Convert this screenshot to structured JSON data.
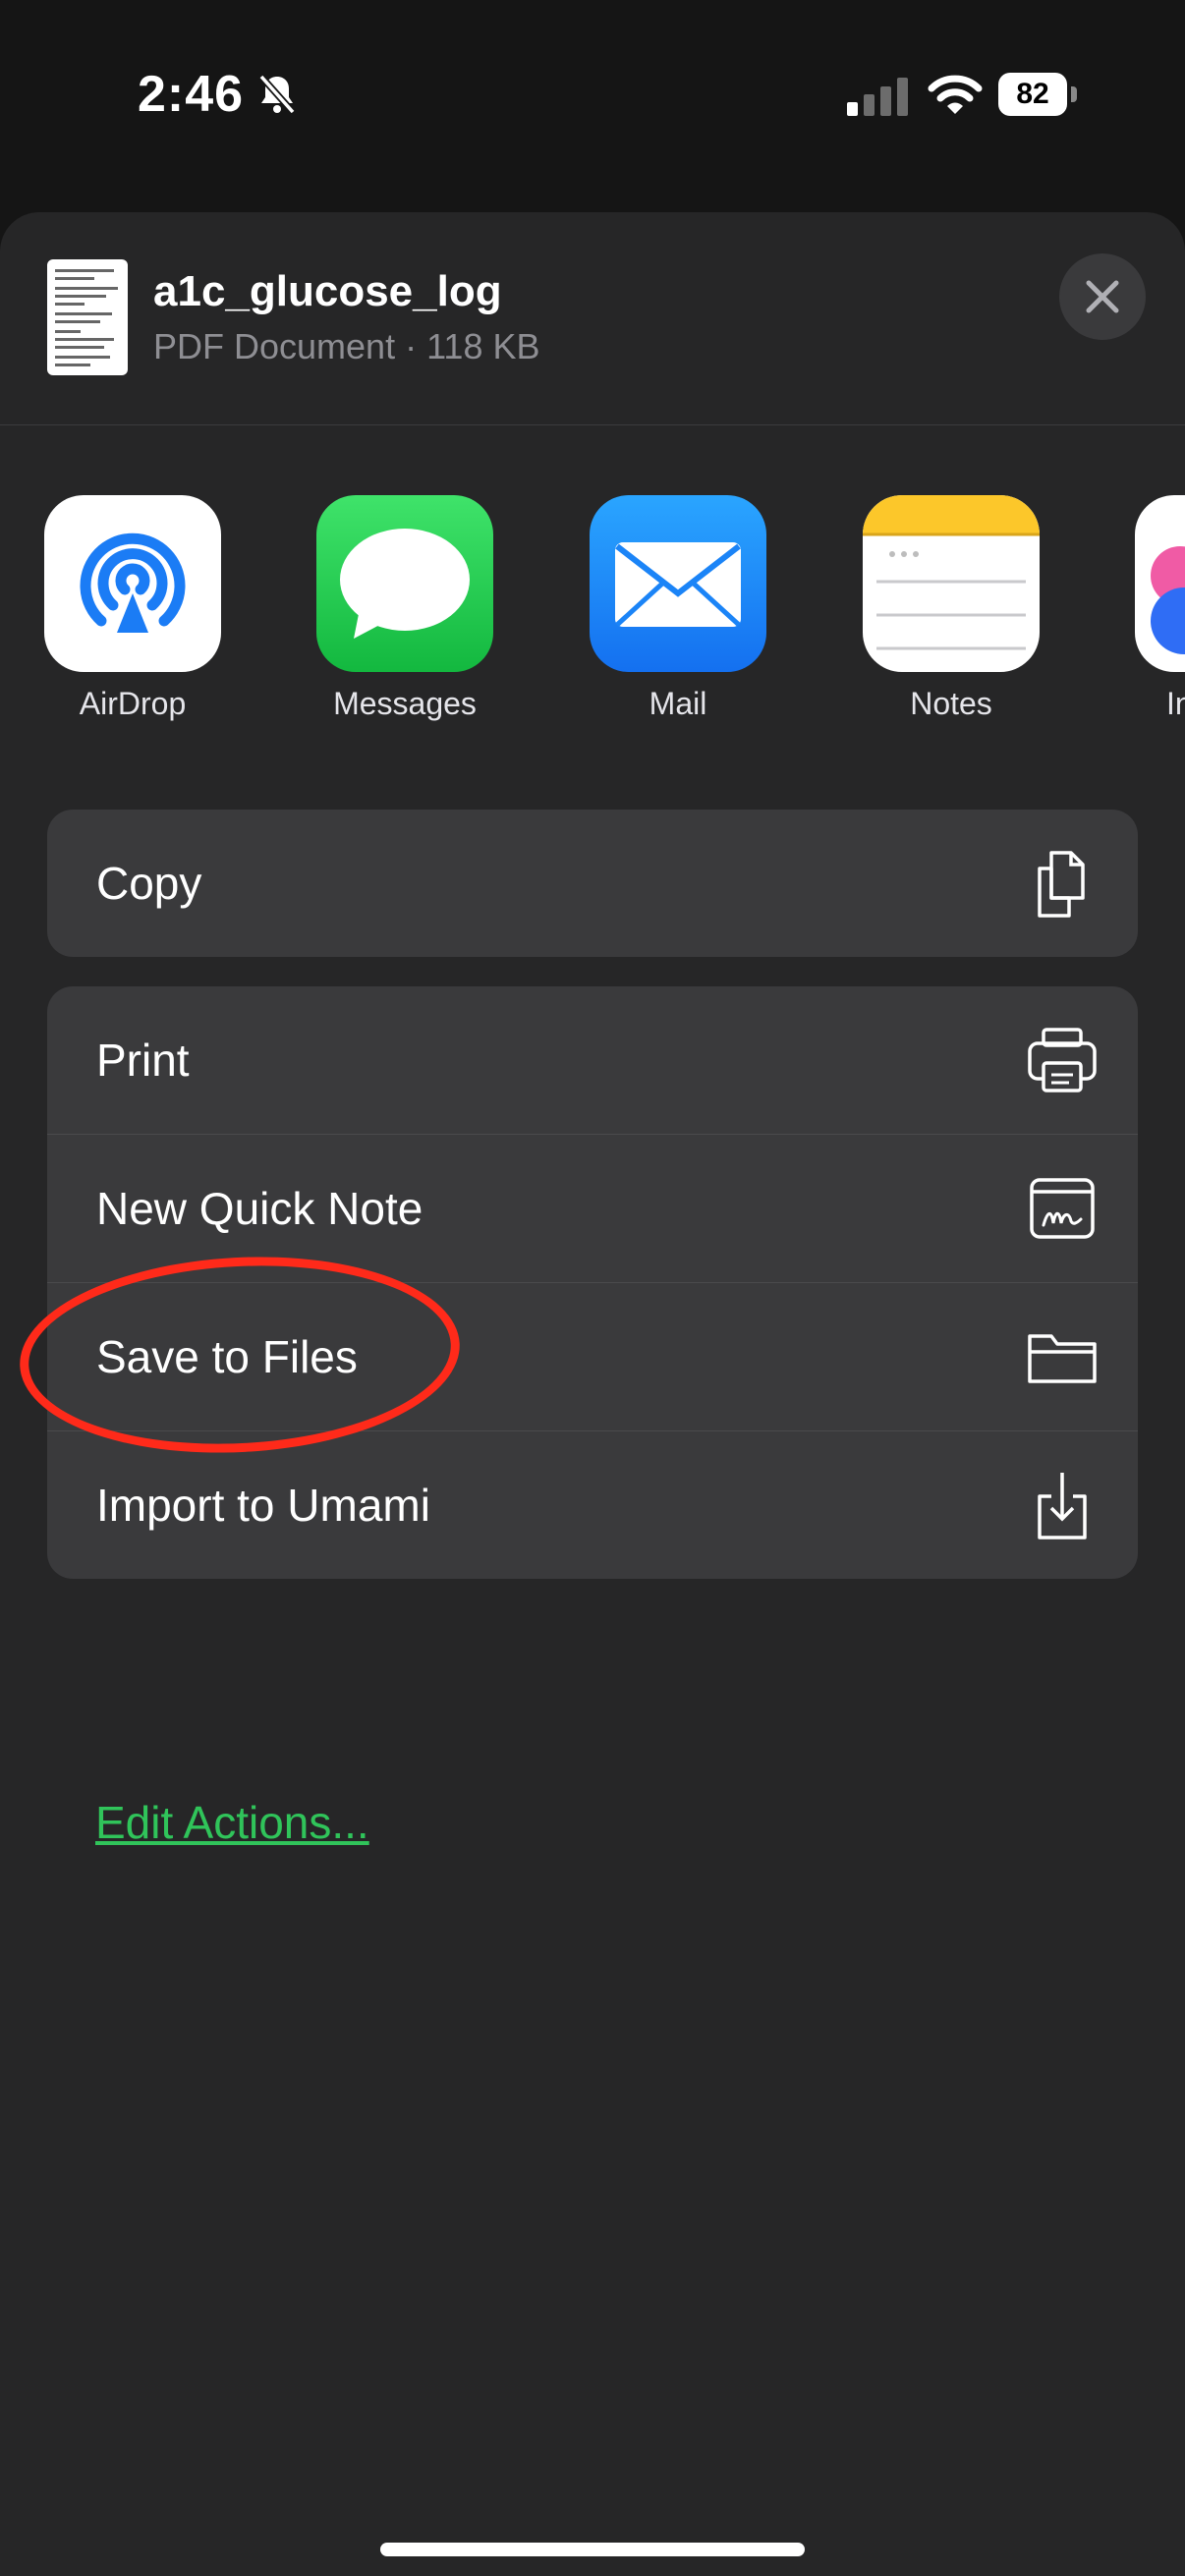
{
  "status": {
    "time": "2:46",
    "battery": "82",
    "icons": [
      "bell-slash-icon",
      "cellular-signal-icon",
      "wifi-icon",
      "battery-icon"
    ]
  },
  "share_header": {
    "title": "a1c_glucose_log",
    "subtitle": "PDF Document · 118 KB",
    "close_icon": "close-icon"
  },
  "apps": [
    {
      "label": "AirDrop",
      "icon": "airdrop-icon"
    },
    {
      "label": "Messages",
      "icon": "messages-icon"
    },
    {
      "label": "Mail",
      "icon": "mail-icon"
    },
    {
      "label": "Notes",
      "icon": "notes-icon"
    },
    {
      "label": "In",
      "icon": "app-icon"
    }
  ],
  "actions": {
    "group1": [
      {
        "label": "Copy",
        "icon": "copy-icon"
      }
    ],
    "group2": [
      {
        "label": "Print",
        "icon": "printer-icon"
      },
      {
        "label": "New Quick Note",
        "icon": "quick-note-icon"
      },
      {
        "label": "Save to Files",
        "icon": "folder-icon"
      },
      {
        "label": "Import to Umami",
        "icon": "import-icon"
      }
    ]
  },
  "edit_actions": "Edit Actions...",
  "colors": {
    "sheet": "#262627",
    "row": "#3a3a3c",
    "edit_link": "#30c45a",
    "highlight": "#ff2a1a"
  }
}
